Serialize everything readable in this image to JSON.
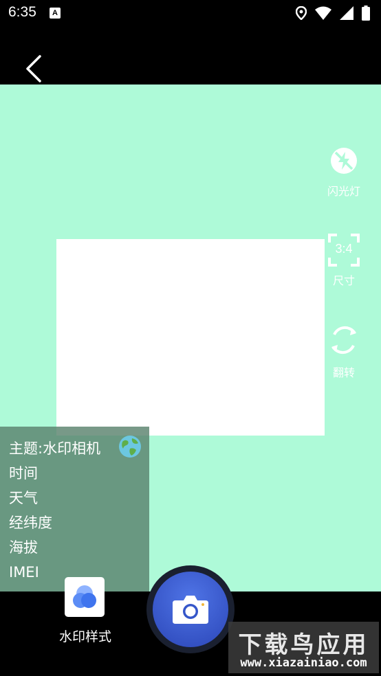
{
  "status_bar": {
    "time": "6:35",
    "notification_glyph": "A",
    "icons": [
      "location-icon",
      "wifi-icon",
      "signal-icon",
      "battery-icon"
    ]
  },
  "side_controls": {
    "flash": {
      "label": "闪光灯",
      "icon": "flash-off-icon"
    },
    "size": {
      "label": "尺寸",
      "ratio": "3:4",
      "icon": "aspect-ratio-icon"
    },
    "flip": {
      "label": "翻转",
      "icon": "flip-camera-icon"
    }
  },
  "info_panel": {
    "theme": "主题:水印相机",
    "time": "时间",
    "weather": "天气",
    "coordinates": "经纬度",
    "altitude": "海拔",
    "imei": "IMEI"
  },
  "bottom": {
    "watermark_style_label": "水印样式"
  },
  "watermark": {
    "title": "下载鸟应用",
    "url": "www.xiazainiao.com"
  },
  "colors": {
    "viewfinder_bg": "#aefad8",
    "shutter_blue": "#3556c9",
    "panel_overlay": "#5a826e"
  }
}
